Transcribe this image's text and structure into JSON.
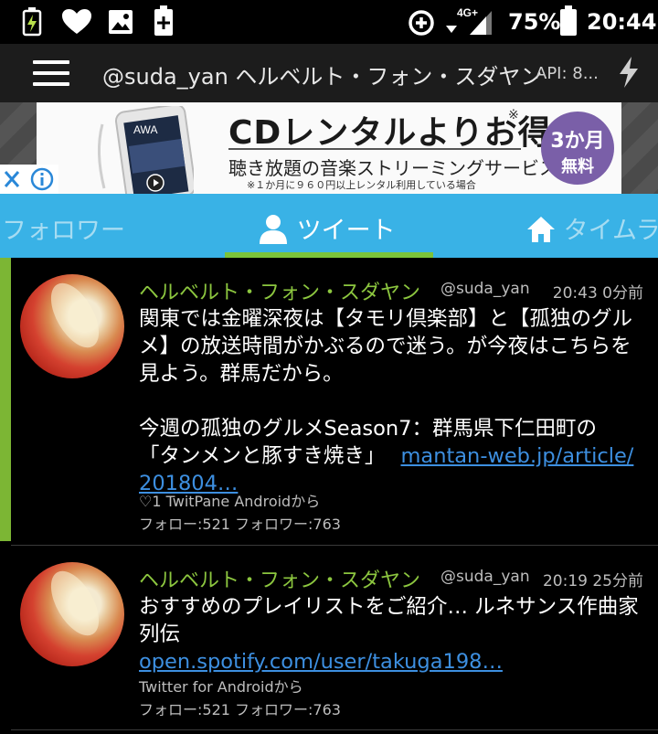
{
  "status_bar": {
    "battery_percent": "75%",
    "time": "20:44",
    "network": "4G+"
  },
  "toolbar": {
    "title": "@suda_yan ヘルベルト・フォン・スダヤン",
    "api": "API: 8..."
  },
  "ad": {
    "headline": "CDレンタルよりお得",
    "asterisk": "※",
    "subtitle": "聴き放題の音楽ストリーミングサービス",
    "note": "※１か月に９６０円以上レンタル利用している場合",
    "badge_line1": "3か月",
    "badge_line2": "無料",
    "phone_brand": "AWA"
  },
  "tabs": [
    {
      "label": "フォロワー"
    },
    {
      "label": "ツイート"
    },
    {
      "label": "タイムラ"
    }
  ],
  "tweets": [
    {
      "name": "ヘルベルト・フォン・スダヤン",
      "handle": "@suda_yan",
      "time": "20:43 0分前",
      "body_line1": "関東では金曜深夜は【タモリ倶楽部】と【孤独のグル",
      "body_line2": "メ】の放送時間がかぶるので迷う。が今夜はこちらを",
      "body_line3": "見よう。群馬だから。",
      "body_line4": "今週の孤独のグルメSeason7：群馬県下仁田町の",
      "body_line5": "「タンメンと豚すき焼き」",
      "link_part1": "mantan-web.jp/article/",
      "link_part2": "201804…",
      "source": "♡1 TwitPane Androidから",
      "counts": "フォロー:521 フォロワー:763"
    },
    {
      "name": "ヘルベルト・フォン・スダヤン",
      "handle": "@suda_yan",
      "time": "20:19 25分前",
      "body_line1": "おすすめのプレイリストをご紹介… ルネサンス作曲家",
      "body_line2": "列伝",
      "link": "open.spotify.com/user/takuga198…",
      "source": "Twitter for Androidから",
      "counts": "フォロー:521 フォロワー:763"
    }
  ],
  "colors": {
    "tab_bar": "#39b2e6",
    "tab_underline": "#7cc33a",
    "name_green": "#8cc63f",
    "link_blue": "#3d8fe0",
    "ad_badge": "#7a5fa8"
  }
}
